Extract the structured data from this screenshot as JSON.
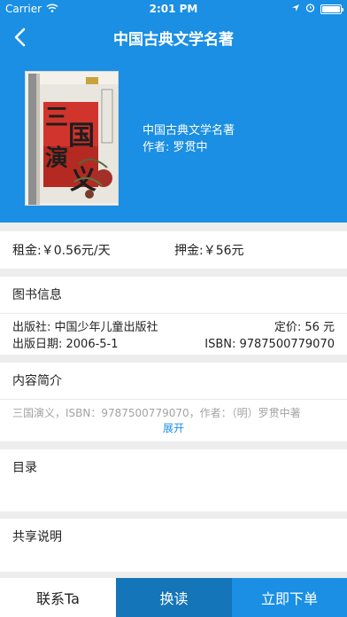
{
  "status_bar": {
    "carrier": "Carrier",
    "time": "2:01 PM"
  },
  "nav": {
    "title": "中国古典文学名著"
  },
  "book": {
    "series": "中国古典文学名著",
    "author": "作者: 罗贯中",
    "cover_title": "三国演义"
  },
  "rent": {
    "rent_label": "租金: ",
    "rent_value": "￥0.56元/天",
    "deposit_label": "押金: ",
    "deposit_value": "￥56元"
  },
  "book_info": {
    "title": "图书信息",
    "publisher": "出版社: 中国少年儿童出版社",
    "price": "定价: 56 元",
    "pub_date": "出版日期: 2006-5-1",
    "isbn": "ISBN: 9787500779070"
  },
  "intro": {
    "title": "内容简介",
    "text": "三国演义，ISBN：9787500779070，作者：（明）罗贯中著",
    "expand_label": "展开"
  },
  "toc": {
    "title": "目录"
  },
  "share": {
    "title": "共享说明"
  },
  "bottom": {
    "contact_label": "联系Ta",
    "swap_label": "换读",
    "order_label": "立即下单"
  },
  "colors": {
    "primary": "#1a8fe3",
    "dark_primary": "#1475b8",
    "background": "#ededed"
  }
}
